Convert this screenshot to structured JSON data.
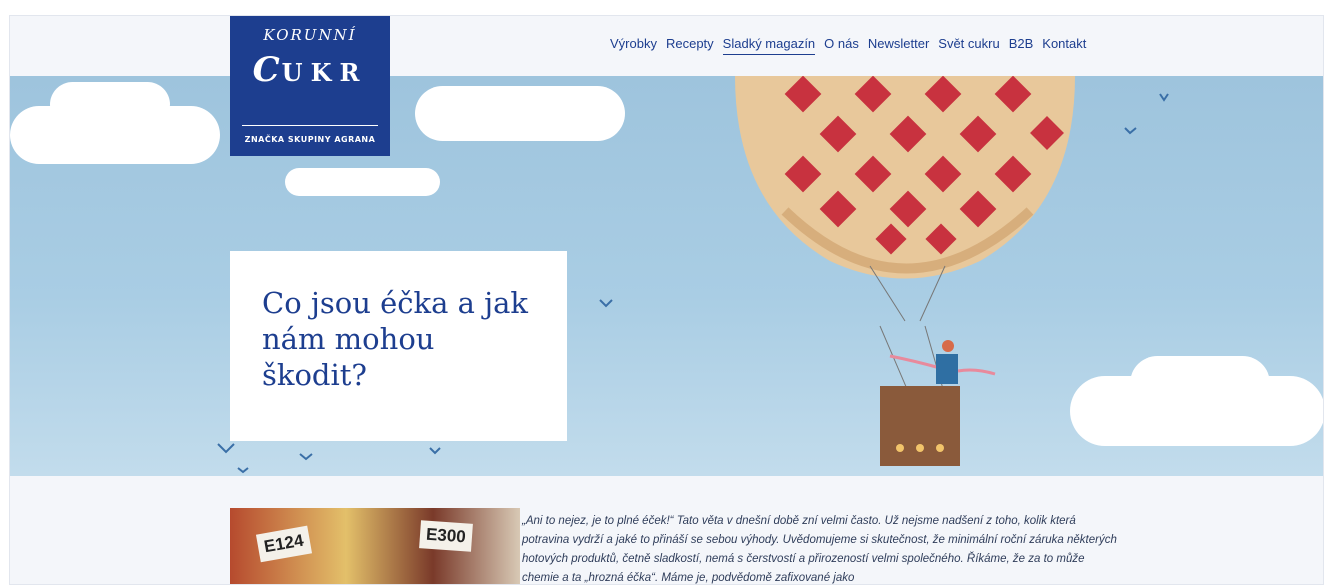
{
  "logo": {
    "top": "KORUNNÍ",
    "main": "UKR",
    "script_initial": "C",
    "tagline": "ZNAČKA SKUPINY AGRANA"
  },
  "nav": {
    "items": [
      {
        "label": "Výrobky"
      },
      {
        "label": "Recepty"
      },
      {
        "label": "Sladký magazín",
        "active": true
      },
      {
        "label": "O nás"
      },
      {
        "label": "Newsletter"
      },
      {
        "label": "Svět cukru"
      },
      {
        "label": "B2B"
      },
      {
        "label": "Kontakt"
      }
    ]
  },
  "hero": {
    "title": "Co jsou éčka a jak nám mohou škodit?"
  },
  "article": {
    "image_tags": [
      "E124",
      "E300"
    ],
    "intro": "„Ani to nejez, je to plné éček!“ Tato věta v dnešní době zní velmi často. Už nejsme nadšení z toho, kolik která potravina vydrží a jaké to přináší se sebou výhody. Uvědomujeme si skutečnost, že minimální roční záruka některých hotových produktů, četně sladkostí, nemá s čerstvostí a přirozeností velmi společného. Říkáme, že za to může chemie a ta „hrozná éčka“. Máme je, podvědomě zafixované jako"
  },
  "colors": {
    "brand_blue": "#1d3e8f",
    "sky": "#a9cde4",
    "pie_red": "#c8323f"
  }
}
